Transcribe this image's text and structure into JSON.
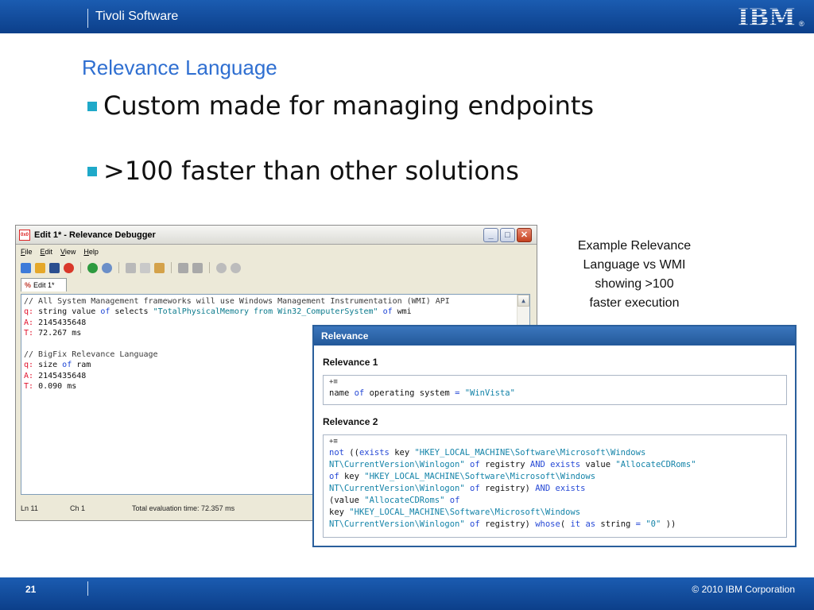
{
  "header": {
    "brand": "Tivoli Software",
    "logo_text": "IBM",
    "logo_mark": "®"
  },
  "slide": {
    "title": "Relevance Language",
    "bullets": [
      "Custom made for managing endpoints",
      ">100 faster than other solutions"
    ],
    "caption": [
      "Example Relevance",
      "Language vs WMI",
      "showing >100",
      "faster execution"
    ]
  },
  "debugger": {
    "window_title": "Edit 1* - Relevance Debugger",
    "app_icon_text": "0x0",
    "window_buttons": [
      "_",
      "□",
      "✕"
    ],
    "menu": [
      "File",
      "Edit",
      "View",
      "Help"
    ],
    "tab_label": "Edit 1*",
    "tab_icon": "%",
    "lines": [
      {
        "parts": [
          {
            "t": "// All System Management frameworks will use Windows Management Instrumentation (WMI) API",
            "c": "c-com"
          }
        ]
      },
      {
        "parts": [
          {
            "t": "q:",
            "c": "c-key"
          },
          {
            "t": " string value ",
            "c": ""
          },
          {
            "t": "of",
            "c": "c-blu"
          },
          {
            "t": " selects ",
            "c": ""
          },
          {
            "t": "\"TotalPhysicalMemory from Win32_ComputerSystem\"",
            "c": "c-str"
          },
          {
            "t": " of",
            "c": "c-blu"
          },
          {
            "t": " wmi",
            "c": ""
          }
        ]
      },
      {
        "parts": [
          {
            "t": "A:",
            "c": "c-key"
          },
          {
            "t": " 2145435648",
            "c": ""
          }
        ]
      },
      {
        "parts": [
          {
            "t": "T:",
            "c": "c-key"
          },
          {
            "t": " 72.267 ms",
            "c": ""
          }
        ]
      },
      {
        "parts": [
          {
            "t": "",
            "c": ""
          }
        ]
      },
      {
        "parts": [
          {
            "t": "// BigFix Relevance Language",
            "c": "c-com"
          }
        ]
      },
      {
        "parts": [
          {
            "t": "q:",
            "c": "c-key"
          },
          {
            "t": " size ",
            "c": ""
          },
          {
            "t": "of",
            "c": "c-blu"
          },
          {
            "t": " ram",
            "c": ""
          }
        ]
      },
      {
        "parts": [
          {
            "t": "A:",
            "c": "c-key"
          },
          {
            "t": " 2145435648",
            "c": ""
          }
        ]
      },
      {
        "parts": [
          {
            "t": "T:",
            "c": "c-key"
          },
          {
            "t": " 0.090 ms",
            "c": ""
          }
        ]
      }
    ],
    "status": {
      "ln": "Ln 11",
      "ch": "Ch 1",
      "total": "Total evaluation time: 72.357 ms"
    }
  },
  "relevance_panel": {
    "title": "Relevance",
    "sections": [
      {
        "heading": "Relevance 1",
        "icon": "+≡",
        "lines": [
          {
            "parts": [
              {
                "t": "name ",
                "c": ""
              },
              {
                "t": "of",
                "c": "k-bl"
              },
              {
                "t": " operating system ",
                "c": ""
              },
              {
                "t": "=",
                "c": "k-bl"
              },
              {
                "t": " \"WinVista\"",
                "c": "k-st"
              }
            ]
          }
        ]
      },
      {
        "heading": "Relevance 2",
        "icon": "+≡",
        "lines": [
          {
            "parts": [
              {
                "t": "not",
                "c": "k-bl"
              },
              {
                "t": " ((",
                "c": ""
              },
              {
                "t": "exists",
                "c": "k-bl"
              },
              {
                "t": " key ",
                "c": ""
              },
              {
                "t": "\"HKEY_LOCAL_MACHINE\\Software\\Microsoft\\Windows",
                "c": "k-st"
              }
            ]
          },
          {
            "parts": [
              {
                "t": "NT\\CurrentVersion\\Winlogon\"",
                "c": "k-st"
              },
              {
                "t": " of",
                "c": "k-bl"
              },
              {
                "t": " registry ",
                "c": ""
              },
              {
                "t": "AND",
                "c": "k-bl"
              },
              {
                "t": " exists",
                "c": "k-bl"
              },
              {
                "t": " value ",
                "c": ""
              },
              {
                "t": "\"AllocateCDRoms\"",
                "c": "k-st"
              }
            ]
          },
          {
            "parts": [
              {
                "t": "of",
                "c": "k-bl"
              },
              {
                "t": " key ",
                "c": ""
              },
              {
                "t": "\"HKEY_LOCAL_MACHINE\\Software\\Microsoft\\Windows",
                "c": "k-st"
              }
            ]
          },
          {
            "parts": [
              {
                "t": "NT\\CurrentVersion\\Winlogon\"",
                "c": "k-st"
              },
              {
                "t": " of",
                "c": "k-bl"
              },
              {
                "t": " registry) ",
                "c": ""
              },
              {
                "t": "AND",
                "c": "k-bl"
              },
              {
                "t": " exists",
                "c": "k-bl"
              }
            ]
          },
          {
            "parts": [
              {
                "t": "(value ",
                "c": ""
              },
              {
                "t": "\"AllocateCDRoms\"",
                "c": "k-st"
              },
              {
                "t": " of",
                "c": "k-bl"
              }
            ]
          },
          {
            "parts": [
              {
                "t": "key ",
                "c": ""
              },
              {
                "t": "\"HKEY_LOCAL_MACHINE\\Software\\Microsoft\\Windows",
                "c": "k-st"
              }
            ]
          },
          {
            "parts": [
              {
                "t": "NT\\CurrentVersion\\Winlogon\"",
                "c": "k-st"
              },
              {
                "t": " of",
                "c": "k-bl"
              },
              {
                "t": " registry) ",
                "c": ""
              },
              {
                "t": "whose",
                "c": "k-bl"
              },
              {
                "t": "( ",
                "c": ""
              },
              {
                "t": "it",
                "c": "k-bl"
              },
              {
                "t": " as",
                "c": "k-bl"
              },
              {
                "t": " string ",
                "c": ""
              },
              {
                "t": "=",
                "c": "k-bl"
              },
              {
                "t": " \"0\"",
                "c": "k-st"
              },
              {
                "t": " ))",
                "c": ""
              }
            ]
          }
        ]
      }
    ]
  },
  "footer": {
    "page_number": "21",
    "copyright": "© 2010 IBM Corporation"
  }
}
